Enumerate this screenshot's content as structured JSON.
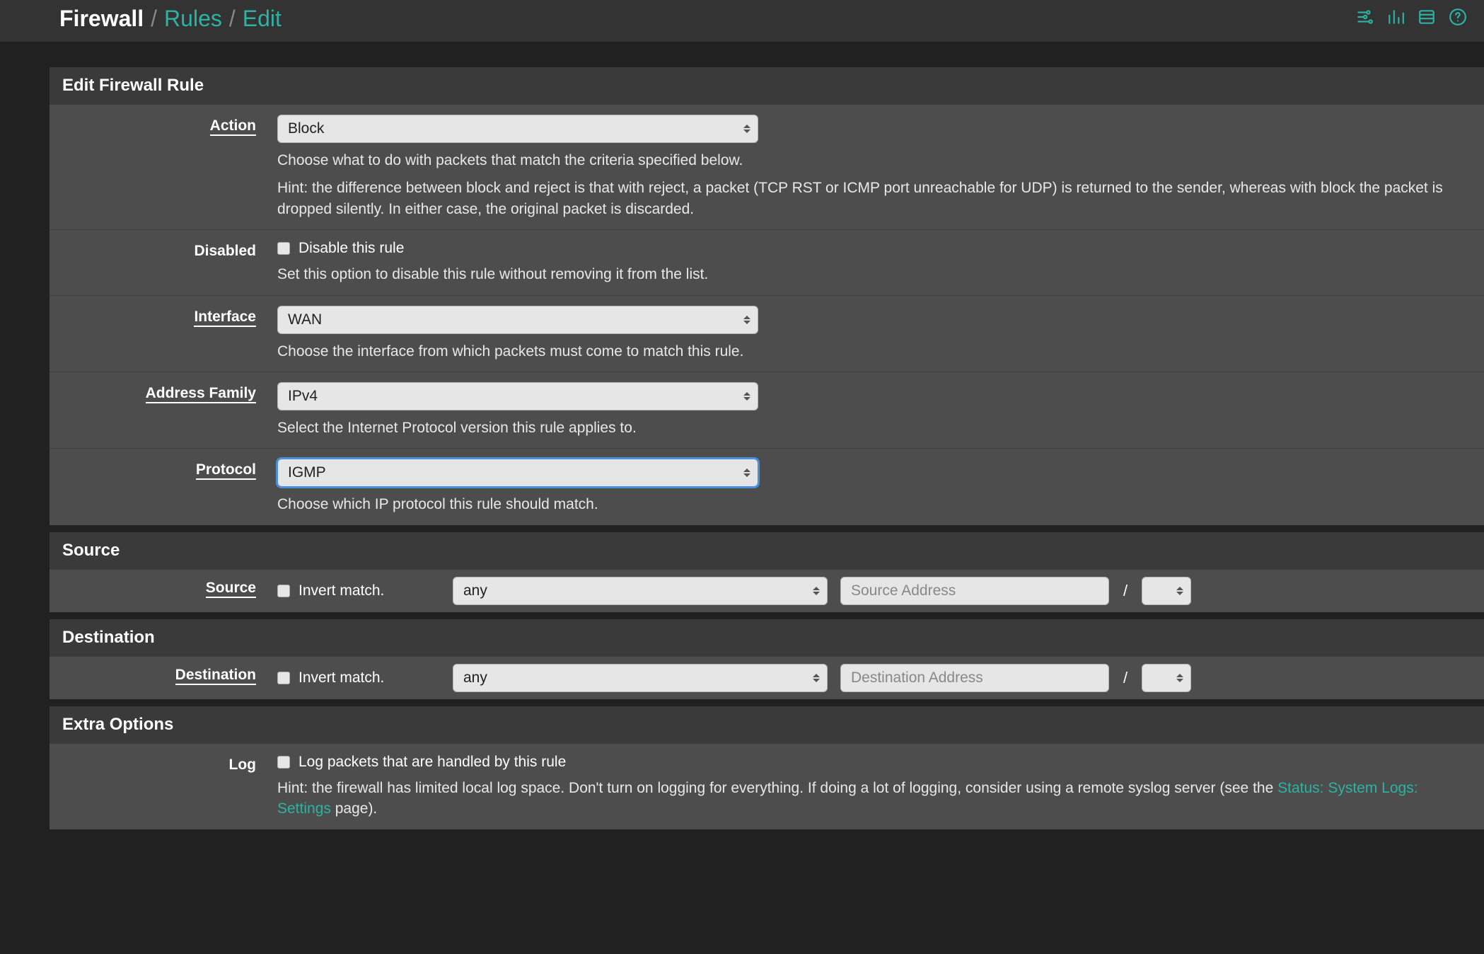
{
  "breadcrumb": {
    "lvl0": "Firewall",
    "lvl1": "Rules",
    "lvl2": "Edit"
  },
  "icons": {
    "sliders": "sliders-icon",
    "bars": "bar-chart-icon",
    "list": "list-icon",
    "help": "help-icon"
  },
  "panels": {
    "edit": {
      "title": "Edit Firewall Rule",
      "action": {
        "label": "Action",
        "value": "Block",
        "help1": "Choose what to do with packets that match the criteria specified below.",
        "help2": "Hint: the difference between block and reject is that with reject, a packet (TCP RST or ICMP port unreachable for UDP) is returned to the sender, whereas with block the packet is dropped silently. In either case, the original packet is discarded."
      },
      "disabled": {
        "label": "Disabled",
        "check_label": "Disable this rule",
        "help": "Set this option to disable this rule without removing it from the list."
      },
      "interface": {
        "label": "Interface",
        "value": "WAN",
        "help": "Choose the interface from which packets must come to match this rule."
      },
      "af": {
        "label": "Address Family",
        "value": "IPv4",
        "help": "Select the Internet Protocol version this rule applies to."
      },
      "protocol": {
        "label": "Protocol",
        "value": "IGMP",
        "help": "Choose which IP protocol this rule should match."
      }
    },
    "source": {
      "title": "Source",
      "row": {
        "label": "Source",
        "invert_label": "Invert match.",
        "type_value": "any",
        "addr_placeholder": "Source Address",
        "mask_sep": "/"
      }
    },
    "destination": {
      "title": "Destination",
      "row": {
        "label": "Destination",
        "invert_label": "Invert match.",
        "type_value": "any",
        "addr_placeholder": "Destination Address",
        "mask_sep": "/"
      }
    },
    "extra": {
      "title": "Extra Options",
      "log": {
        "label": "Log",
        "check_label": "Log packets that are handled by this rule",
        "hint_pre": "Hint: the firewall has limited local log space. Don't turn on logging for everything. If doing a lot of logging, consider using a remote syslog server (see the ",
        "hint_link": "Status: System Logs: Settings",
        "hint_post": " page)."
      }
    }
  }
}
